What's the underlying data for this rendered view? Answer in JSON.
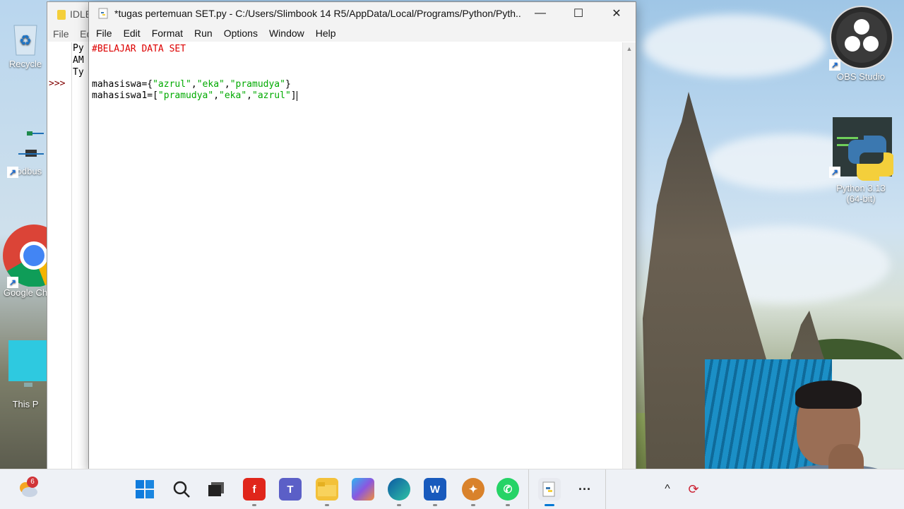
{
  "desktop": {
    "icons_left": [
      {
        "label": "Recycle",
        "icon": "recycle-bin-icon"
      },
      {
        "label": "Modbus",
        "icon": "modbus-icon"
      },
      {
        "label": "Google Ch",
        "icon": "chrome-icon"
      },
      {
        "label": "This P",
        "icon": "this-pc-icon"
      }
    ],
    "icons_right": [
      {
        "label": "OBS Studio",
        "icon": "obs-icon"
      },
      {
        "label": "Python 3.13",
        "label2": "(64-bit)",
        "icon": "python-icon"
      }
    ]
  },
  "shell_window": {
    "title": "IDLE",
    "menu": [
      "File",
      "Ed"
    ],
    "lines": [
      "Py",
      "AM",
      "Ty"
    ],
    "prompt": ">>>"
  },
  "editor": {
    "title": "*tugas pertemuan SET.py - C:/Users/Slimbook 14 R5/AppData/Local/Programs/Python/Pyth...",
    "menu": [
      "File",
      "Edit",
      "Format",
      "Run",
      "Options",
      "Window",
      "Help"
    ],
    "code": {
      "comment": "#BELAJAR DATA SET",
      "line1_var": "mahasiswa={",
      "line1_strings": [
        "\"azrul\"",
        "\"eka\"",
        "\"pramudya\""
      ],
      "line1_end": "}",
      "line2_var": "mahasiswa1=[",
      "line2_strings": [
        "\"pramudya\"",
        "\"eka\"",
        "\"azrul\""
      ],
      "line2_end": "]",
      "separator": ","
    }
  },
  "window_controls": {
    "minimize": "—",
    "maximize": "☐",
    "close": "✕"
  },
  "taskbar": {
    "weather_badge": "6",
    "apps": [
      "start",
      "search",
      "task-view",
      "foxit",
      "teams",
      "file-explorer",
      "copilot",
      "edge",
      "word",
      "app-badge",
      "whatsapp",
      "idle",
      "more"
    ],
    "more_label": "···",
    "tray_chevron": "^"
  },
  "colors": {
    "comment": "#dd0000",
    "string": "#00aa00",
    "accent": "#0078d4"
  }
}
